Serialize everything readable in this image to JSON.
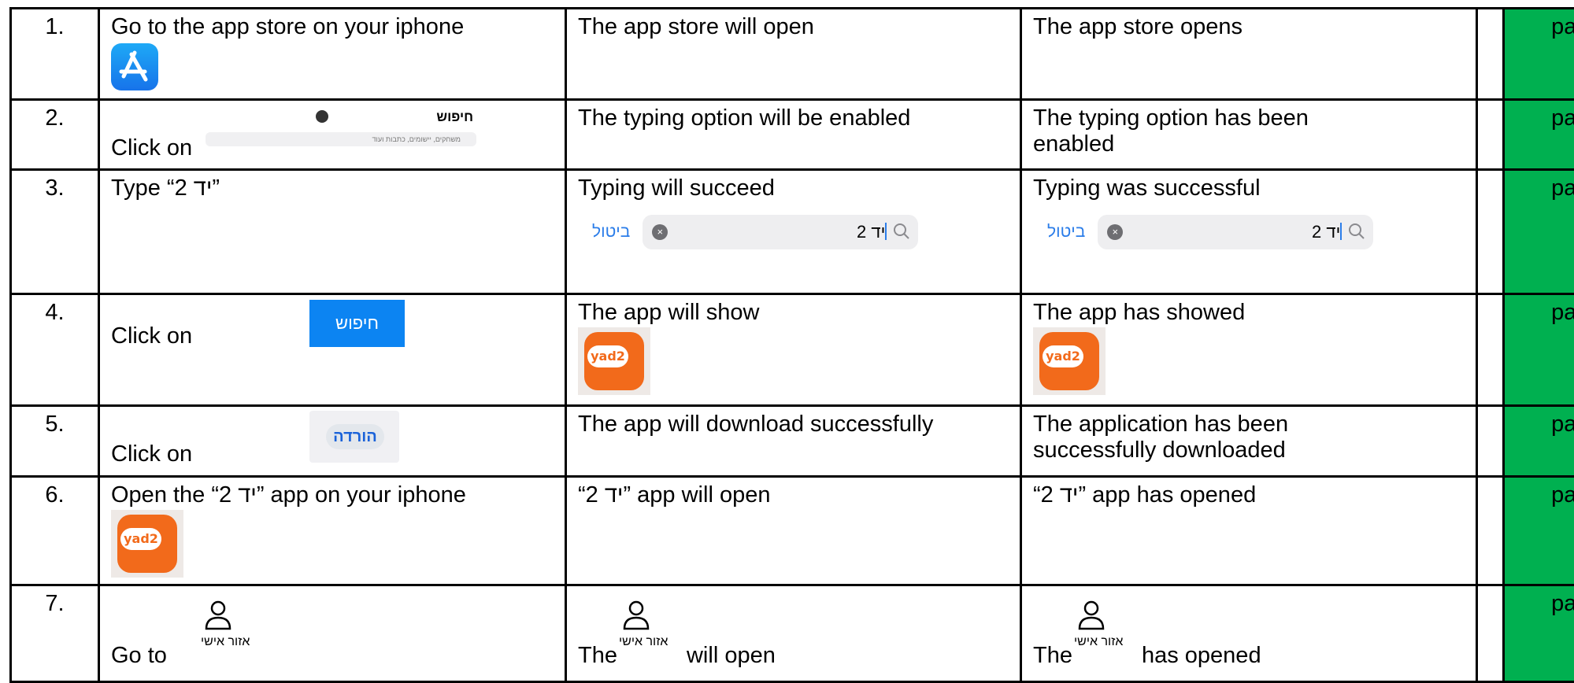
{
  "rows": [
    {
      "num": "1.",
      "step": "Go to the app store on your iphone",
      "expected": "The app store will open",
      "actual": "The app store opens",
      "result": "pass"
    },
    {
      "num": "2.",
      "step": "Click on",
      "expected": "The typing option will be enabled",
      "actual_line1": "The typing option has been",
      "actual_line2": "enabled",
      "result": "pass",
      "step_image": {
        "title": "חיפוש",
        "placeholder": "משחקים, יישומים, כתבות ועוד"
      }
    },
    {
      "num": "3.",
      "step": "Type “2 יד”",
      "expected": "Typing will succeed",
      "actual": "Typing was successful",
      "result": "pass",
      "search": {
        "cancel": "ביטול",
        "query": "יד 2"
      }
    },
    {
      "num": "4.",
      "step": "Click on",
      "expected": "The app will show",
      "actual": "The app has showed",
      "result": "pass",
      "button_label": "חיפוש",
      "app_icon_text": "yad2"
    },
    {
      "num": "5.",
      "step": "Click on",
      "expected": "The app will download successfully",
      "actual_line1": "The application has been",
      "actual_line2": "successfully downloaded",
      "result": "pass",
      "button_label": "הורדה"
    },
    {
      "num": "6.",
      "step": "Open the “2 יד” app on your iphone",
      "expected": "“2 יד” app will open",
      "actual": "“2 יד” app has opened",
      "result": "pass",
      "app_icon_text": "yad2"
    },
    {
      "num": "7.",
      "step": "Go to",
      "expected_pre": "The",
      "expected_post": "will open",
      "actual_pre": "The",
      "actual_post": "has opened",
      "result": "pass",
      "area_label": "אזור אישי"
    }
  ],
  "colors": {
    "pass_fill": "#00b050",
    "link_blue": "#2b7de9",
    "yad2_orange": "#f26a1b",
    "button_blue": "#0c84f2"
  },
  "icons": [
    "app-store-icon",
    "yad2-app-icon",
    "search-icon",
    "clear-icon",
    "person-icon"
  ]
}
